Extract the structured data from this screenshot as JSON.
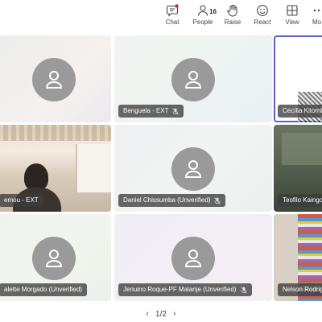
{
  "toolbar": {
    "chat_label": "Chat",
    "people_label": "People",
    "people_count": "16",
    "raise_label": "Raise",
    "react_label": "React",
    "view_label": "View",
    "more_label": "Mo"
  },
  "tiles": [
    {
      "name": ""
    },
    {
      "name": "Benguela - EXT"
    },
    {
      "name": "Cecília Kitomb"
    },
    {
      "name": "emou - EXT"
    },
    {
      "name": "Daniel Chissumba (Unverified)"
    },
    {
      "name": "Teofilo Kaingo"
    },
    {
      "name": "alette Morgado (Unverified)"
    },
    {
      "name": "Jenuino Roque-PF Malanje (Unverified)"
    },
    {
      "name": "Nelson Rodrig"
    }
  ],
  "pager": {
    "text": "1/2",
    "prev_icon": "chevron-left-icon",
    "next_icon": "chevron-right-icon"
  },
  "colors": {
    "accent": "#5b5fc7",
    "avatar": "#9a9a9a",
    "chip_bg": "#3c3c3c"
  }
}
